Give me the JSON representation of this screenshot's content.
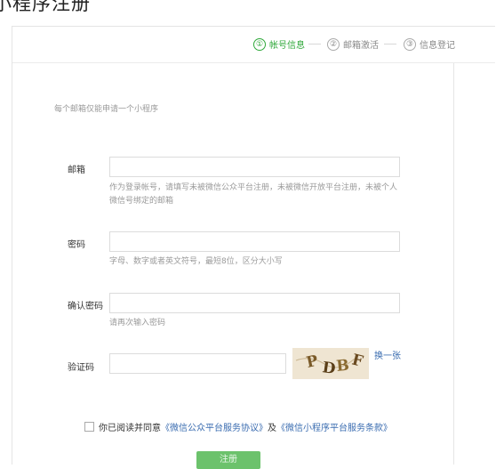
{
  "page": {
    "title": "小程序注册"
  },
  "steps": [
    {
      "num": "①",
      "label": "帐号信息"
    },
    {
      "num": "②",
      "label": "邮箱激活"
    },
    {
      "num": "③",
      "label": "信息登记"
    }
  ],
  "notice": "每个邮箱仅能申请一个小程序",
  "form": {
    "email": {
      "label": "邮箱",
      "value": "",
      "hint": "作为登录帐号，请填写未被微信公众平台注册，未被微信开放平台注册，未被个人微信号绑定的邮箱"
    },
    "password": {
      "label": "密码",
      "value": "",
      "hint": "字母、数字或者英文符号，最短8位，区分大小写"
    },
    "confirm": {
      "label": "确认密码",
      "value": "",
      "hint": "请再次输入密码"
    },
    "captcha": {
      "label": "验证码",
      "value": "",
      "image_text": "PDBF",
      "refresh": "换一张"
    }
  },
  "agreement": {
    "prefix": "你已阅读并同意",
    "link1": "《微信公众平台服务协议》",
    "and": "及",
    "link2": "《微信小程序平台服务条款》"
  },
  "submit_label": "注册",
  "colors": {
    "accent": "#2fa83a",
    "link": "#3a6cb0",
    "button": "#6cc26c"
  }
}
